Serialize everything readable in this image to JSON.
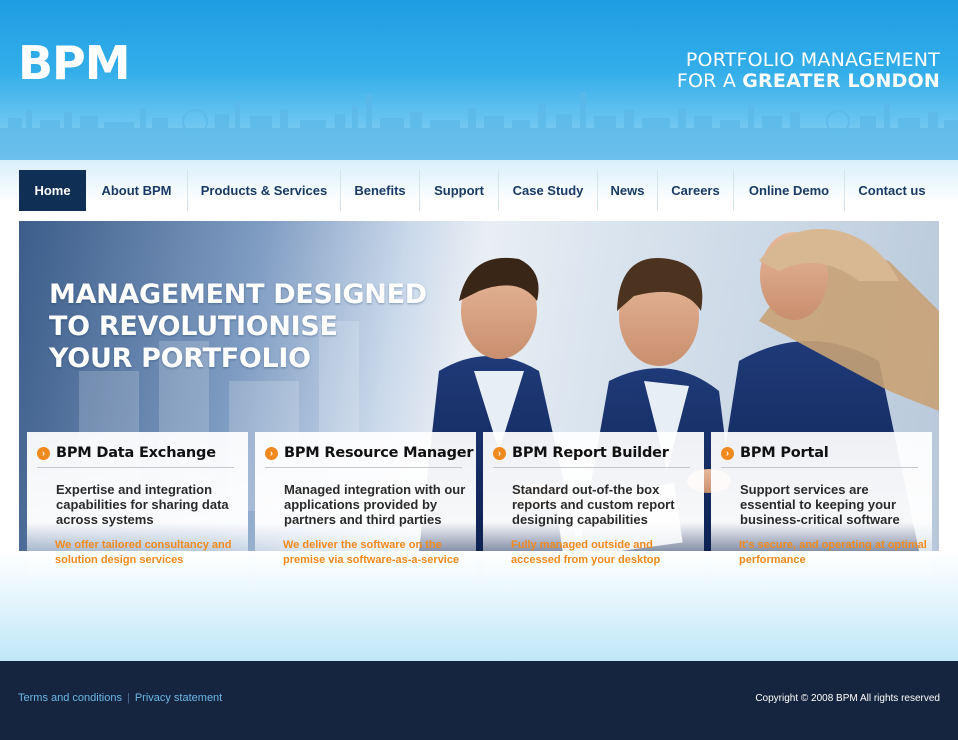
{
  "header": {
    "logo": "BPM",
    "tagline_line1": "PORTFOLIO MANAGEMENT",
    "tagline_line2_prefix": "FOR A ",
    "tagline_line2_bold": "GREATER LONDON"
  },
  "nav": {
    "items": [
      {
        "label": "Home",
        "active": true
      },
      {
        "label": "About BPM"
      },
      {
        "label": "Products & Services"
      },
      {
        "label": "Benefits"
      },
      {
        "label": "Support"
      },
      {
        "label": "Case Study"
      },
      {
        "label": "News"
      },
      {
        "label": "Careers"
      },
      {
        "label": "Online Demo"
      },
      {
        "label": "Contact us"
      }
    ]
  },
  "hero": {
    "title_line1": "MANAGEMENT DESIGNED",
    "title_line2": "TO REVOLUTIONISE",
    "title_line3": "YOUR PORTFOLIO"
  },
  "cards": [
    {
      "title": "BPM Data Exchange",
      "description": "Expertise and integration capabilities for sharing data across systems",
      "note": "We offer tailored consultancy and solution design services"
    },
    {
      "title": "BPM Resource Manager",
      "description": "Managed integration with our applications provided by partners and third parties",
      "note": "We deliver the software on the premise via software-as-a-service"
    },
    {
      "title": "BPM Report Builder",
      "description": "Standard out-of-the box reports and custom report designing capabilities",
      "note": "Fully managed outside and accessed from your desktop"
    },
    {
      "title": "BPM Portal",
      "description": "Support services are essential to keeping your business-critical software",
      "note": "It's  secure, and operating at optimal performance"
    }
  ],
  "footer": {
    "terms": "Terms and conditions",
    "separator": "|",
    "privacy": "Privacy statement",
    "copyright": "Copyright © 2008 BPM All rights reserved"
  },
  "colors": {
    "header_blue": "#1e9de3",
    "nav_active": "#0f2f55",
    "nav_text": "#1a3a66",
    "accent_orange": "#f08a1e",
    "footer_bg": "#16253f",
    "footer_link": "#6cb7e6"
  },
  "icons": {
    "card_bullet": "orange-arrow-circle-icon"
  }
}
